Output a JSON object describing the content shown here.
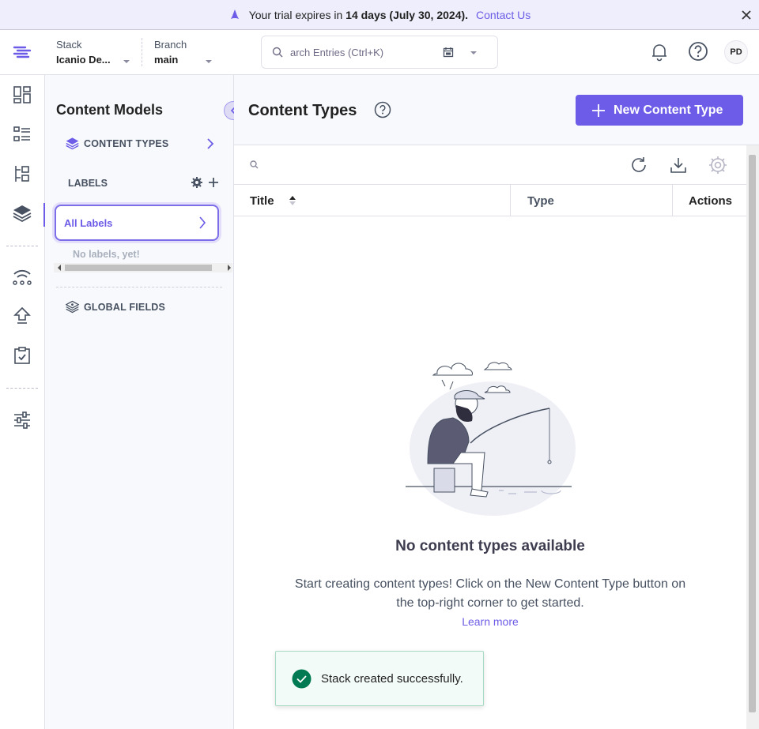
{
  "banner": {
    "prefix": "Your trial expires in ",
    "highlight": "14 days (July 30, 2024).",
    "contact_link": "Contact Us"
  },
  "header": {
    "stack_label": "Stack",
    "stack_value": "Icanio De...",
    "branch_label": "Branch",
    "branch_value": "main",
    "search_placeholder": "arch Entries (Ctrl+K)",
    "avatar_initials": "PD"
  },
  "panel": {
    "title": "Content Models",
    "content_types": "CONTENT TYPES",
    "labels_header": "LABELS",
    "all_labels": "All Labels",
    "no_labels": "No labels, yet!",
    "global_fields": "GLOBAL FIELDS"
  },
  "main": {
    "title": "Content Types",
    "new_button": "New Content Type",
    "columns": [
      "Title",
      "Type",
      "Actions"
    ],
    "empty_title": "No content types available",
    "empty_desc": "Start creating content types! Click on the New Content Type button on the top-right corner to get started.",
    "learn_more": "Learn more"
  },
  "toast": {
    "message": "Stack created successfully."
  },
  "colors": {
    "accent": "#6c5ce7",
    "success": "#007a52"
  },
  "icons": {
    "rail": [
      "dashboard-icon",
      "entries-icon",
      "assets-icon",
      "content-models-icon",
      "webhooks-icon",
      "deploy-icon",
      "releases-icon",
      "settings-icon"
    ]
  }
}
